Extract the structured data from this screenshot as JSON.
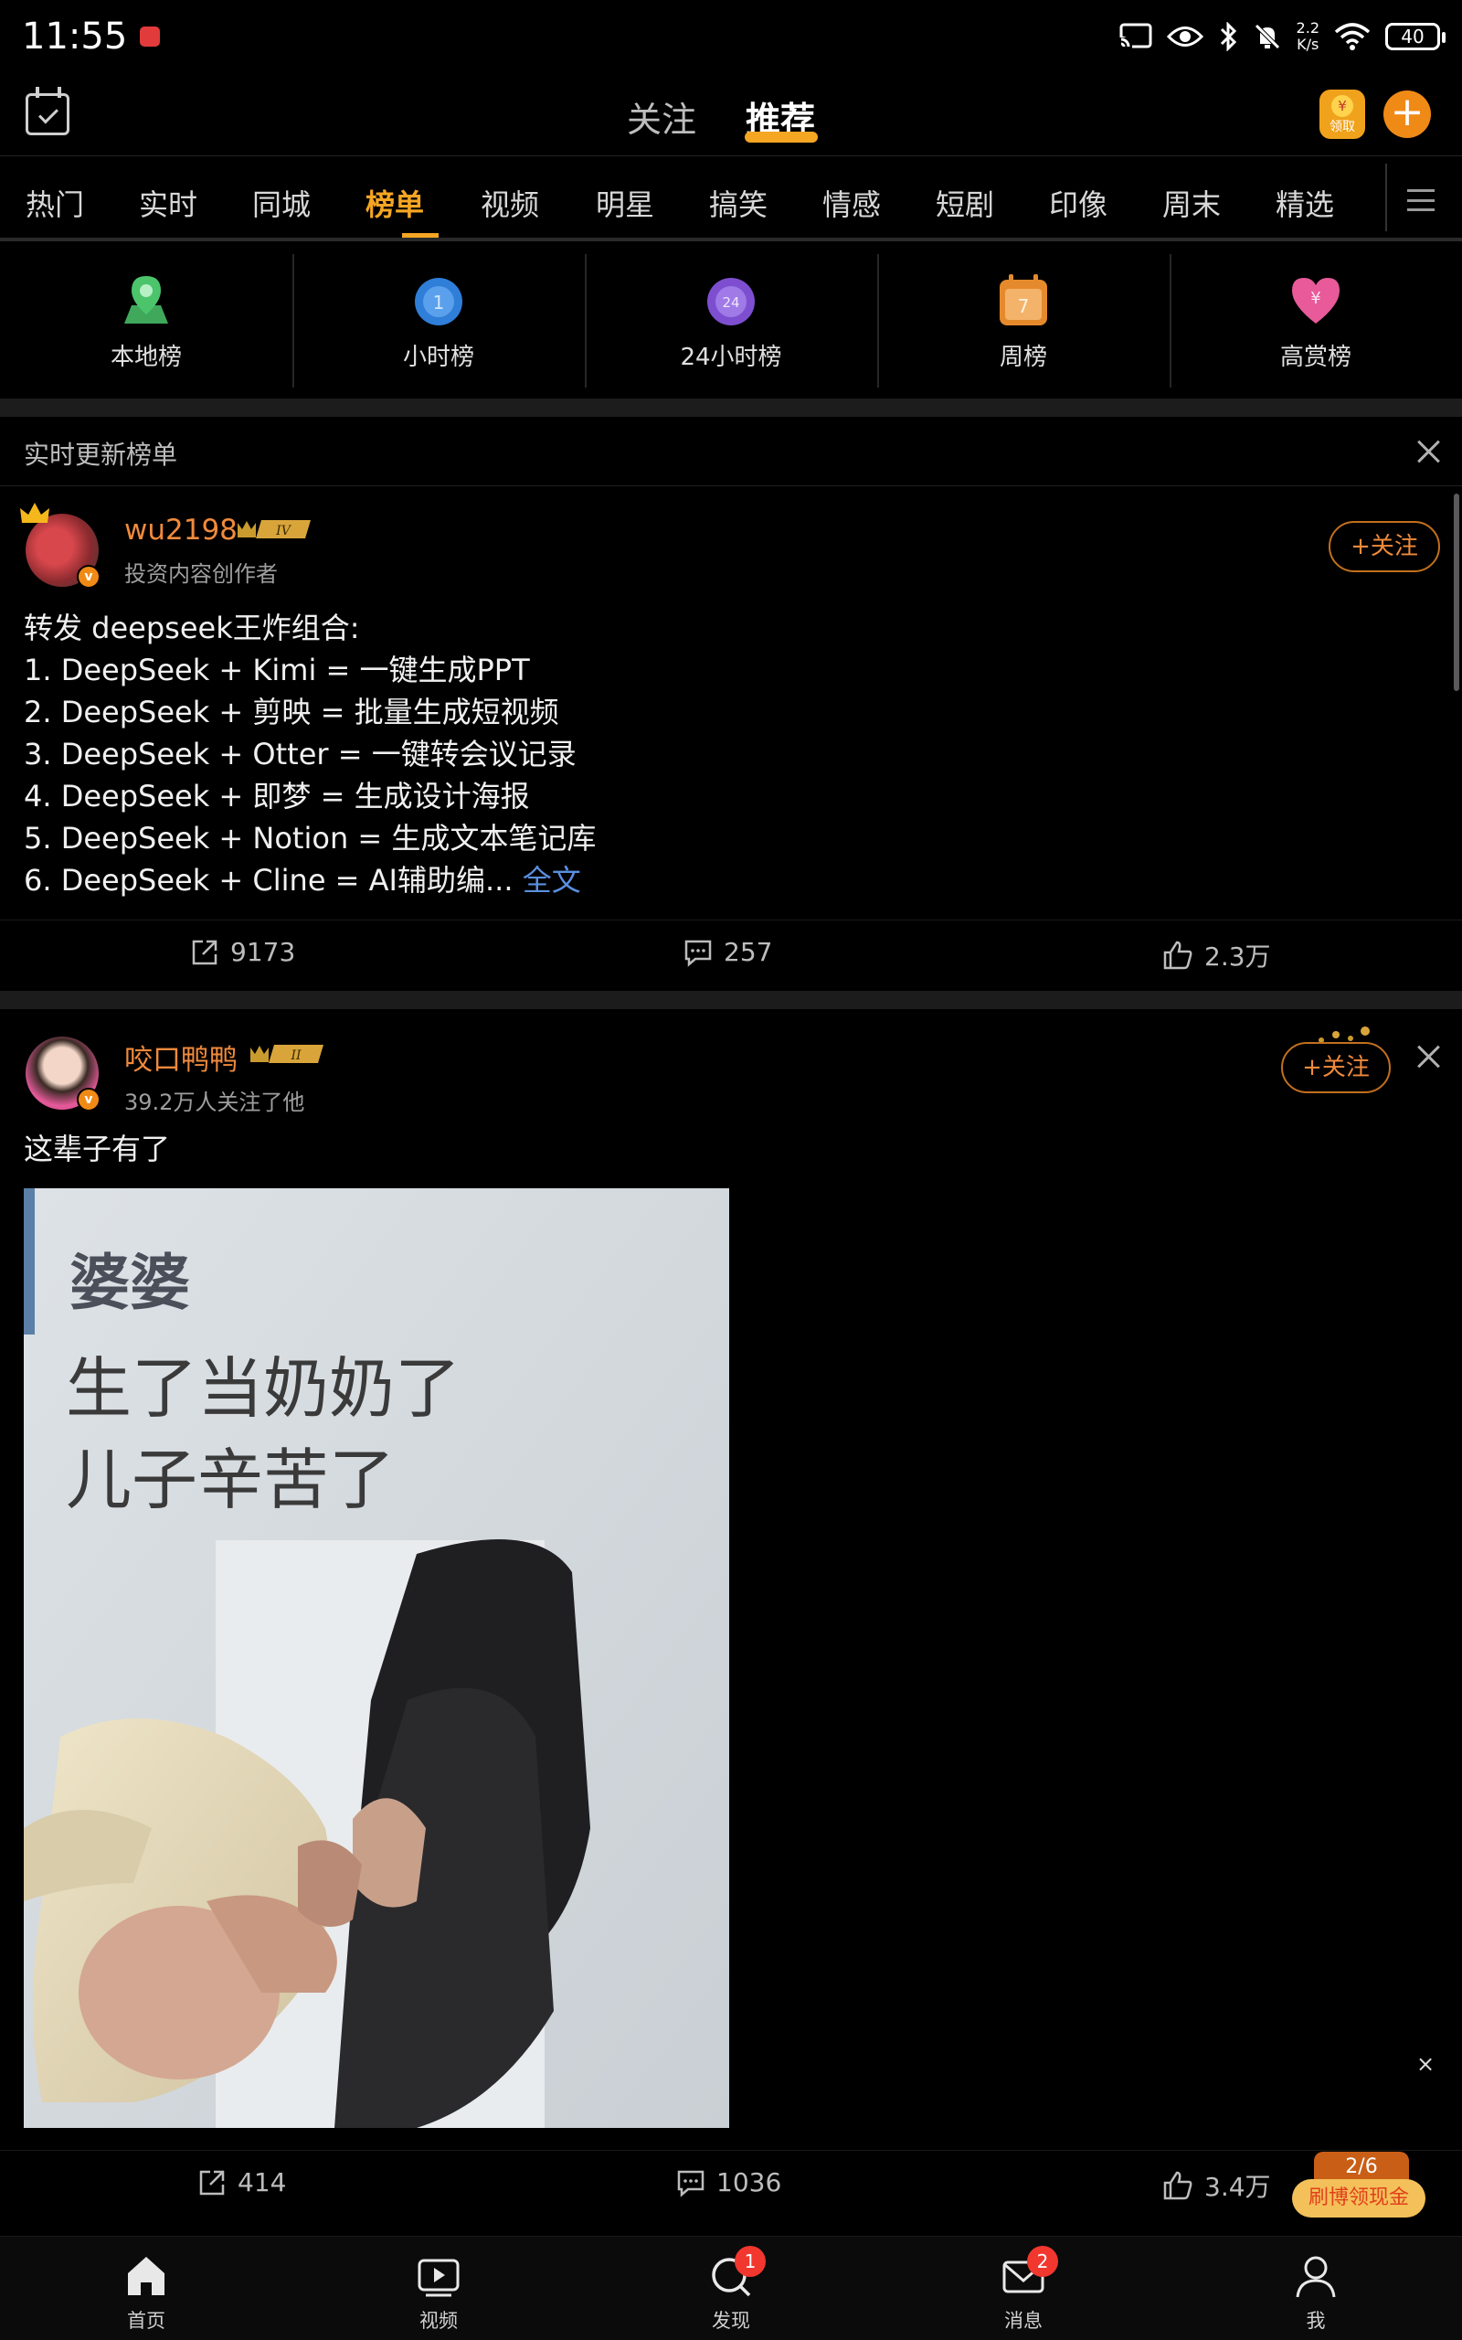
{
  "status": {
    "time": "11:55",
    "net_speed_top": "2.2",
    "net_speed_unit": "K/s",
    "battery": "40"
  },
  "topnav": {
    "follow": "关注",
    "recommend": "推荐",
    "redpack_label": "领取",
    "redpack_coin": "¥"
  },
  "categories": [
    "热门",
    "实时",
    "同城",
    "榜单",
    "视频",
    "明星",
    "搞笑",
    "情感",
    "短剧",
    "印像",
    "周末",
    "精选"
  ],
  "ranks": [
    {
      "label": "本地榜",
      "icon": "location-pin-icon"
    },
    {
      "label": "小时榜",
      "icon": "hour-clock-icon",
      "glyph": "1"
    },
    {
      "label": "24小时榜",
      "icon": "24h-clock-icon",
      "glyph": "24"
    },
    {
      "label": "周榜",
      "icon": "calendar-icon",
      "glyph": "7"
    },
    {
      "label": "高赏榜",
      "icon": "heart-yen-icon",
      "glyph": "¥"
    }
  ],
  "realtime": {
    "title": "实时更新榜单"
  },
  "post1": {
    "username": "wu2198",
    "level": "IV",
    "subline": "投资内容创作者",
    "follow_label": "+关注",
    "text": "转发 deepseek王炸组合:\n1. DeepSeek + Kimi = 一键生成PPT\n2. DeepSeek + 剪映 = 批量生成短视频\n3. DeepSeek + Otter = 一键转会议记录\n4. DeepSeek + 即梦 = 生成设计海报\n5. DeepSeek + Notion = 生成文本笔记库\n6. DeepSeek + Cline = AI辅助编...",
    "more": "全文",
    "reposts": "9173",
    "comments": "257",
    "likes": "2.3万"
  },
  "post2": {
    "username": "咬口鸭鸭",
    "level": "II",
    "subline": "39.2万人关注了他",
    "follow_label": "+关注",
    "text": "这辈子有了",
    "photo_caption_1": "婆婆",
    "photo_caption_2": "生了当奶奶了",
    "photo_caption_3": "儿子辛苦了",
    "reposts": "414",
    "comments": "1036",
    "likes": "3.4万"
  },
  "floating": {
    "close": "×",
    "count": "2/6",
    "label": "刷博领现金"
  },
  "bottom": [
    {
      "label": "首页",
      "badge": ""
    },
    {
      "label": "视频",
      "badge": ""
    },
    {
      "label": "发现",
      "badge": "1"
    },
    {
      "label": "消息",
      "badge": "2"
    },
    {
      "label": "我",
      "badge": ""
    }
  ],
  "colors": {
    "accent": "#f5a623",
    "username": "#f08a3c",
    "link": "#5a8fe0",
    "badge": "#f2372f"
  }
}
